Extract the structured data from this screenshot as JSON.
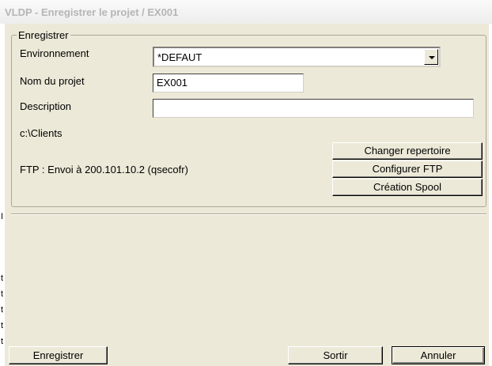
{
  "window": {
    "title": "VLDP - Enregistrer le projet / EX001"
  },
  "group": {
    "legend": "Enregistrer"
  },
  "form": {
    "environnement_label": "Environnement",
    "environnement_value": "*DEFAUT",
    "nom_label": "Nom du projet",
    "nom_value": "EX001",
    "description_label": "Description",
    "description_value": "",
    "path": "c:\\Clients",
    "ftp_info": "FTP : Envoi à 200.101.10.2 (qsecofr)"
  },
  "actions": {
    "changer_repertoire": "Changer repertoire",
    "configurer_ftp": "Configurer FTP",
    "creation_spool": "Création Spool"
  },
  "footer": {
    "enregistrer": "Enregistrer",
    "sortir": "Sortir",
    "annuler": "Annuler"
  },
  "colors": {
    "window_bg": "#ece9d8",
    "title_text": "#b5b5b5"
  }
}
